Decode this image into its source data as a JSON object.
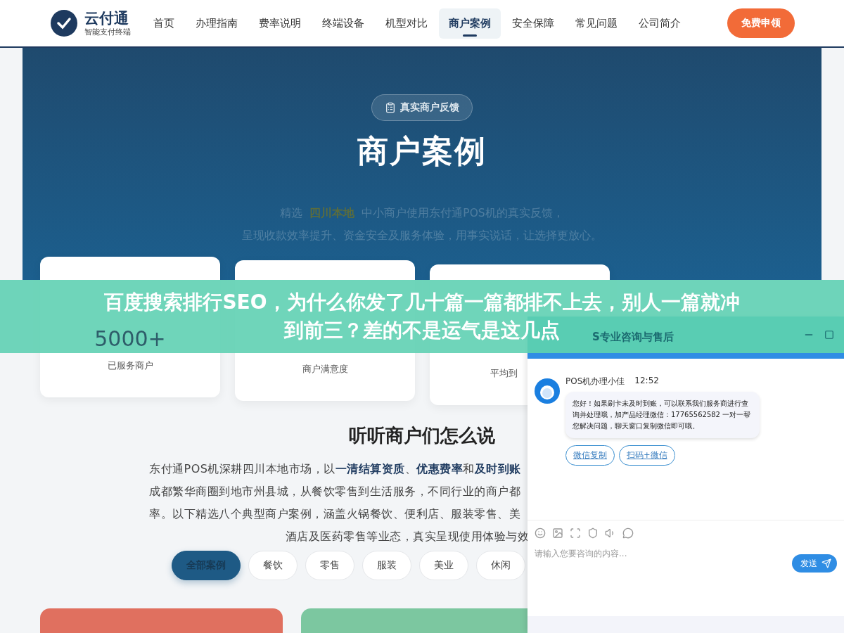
{
  "header": {
    "logo": {
      "name": "云付通",
      "tagline": "智能支付终端"
    },
    "nav": [
      {
        "label": "首页",
        "selected": false
      },
      {
        "label": "办理指南",
        "selected": false
      },
      {
        "label": "费率说明",
        "selected": false
      },
      {
        "label": "终端设备",
        "selected": false
      },
      {
        "label": "机型对比",
        "selected": false
      },
      {
        "label": "商户案例",
        "selected": true
      },
      {
        "label": "安全保障",
        "selected": false
      },
      {
        "label": "常见问题",
        "selected": false
      },
      {
        "label": "公司简介",
        "selected": false
      }
    ],
    "cta": "免费申领"
  },
  "hero": {
    "badge": "真实商户反馈",
    "title": "商户案例",
    "subtitle": {
      "lead": "精选",
      "highlight": "四川本地",
      "rest": "中小商户使用东付通POS机的真实反馈，",
      "line2": "呈现收款效率提升、资金安全及服务体验，用事实说话，让选择更放心。"
    }
  },
  "stats": [
    {
      "value": "5000+",
      "label": "已服务商户"
    },
    {
      "label": "商户满意度"
    },
    {
      "label": "平均到"
    }
  ],
  "section": {
    "title": "听听商户们怎么说",
    "intro_lines": [
      "东付通POS机深耕四川本地市场，以**一清结算资质**、**优惠费率**和**及时到账**",
      "成都繁华商圈到地市州县城，从餐饮零售到生活服务，不同行业的商户都",
      "率。以下精选八个典型商户案例，涵盖火锅餐饮、便利店、服装零售、美",
      "酒店及医药零售等业态，真实呈现使用体验与效"
    ],
    "filters": [
      {
        "label": "全部案例",
        "selected": true
      },
      {
        "label": "餐饮",
        "selected": false
      },
      {
        "label": "零售",
        "selected": false
      },
      {
        "label": "服装",
        "selected": false
      },
      {
        "label": "美业",
        "selected": false
      },
      {
        "label": "休闲",
        "selected": false
      }
    ],
    "case_cards": [
      {
        "color": "#e0705f"
      },
      {
        "color": "#7cc7a0"
      }
    ]
  },
  "banner": {
    "title_lines": [
      "百度搜索排行SEO，为什么你发了几十篇一篇都排不上去，别人一篇就冲",
      "到前三？差的不是运气是这几点"
    ]
  },
  "chat": {
    "title": "S专业咨询与售后",
    "message": {
      "sender": "POS机办理小佳",
      "time": "12:52",
      "text": "您好！如果刷卡未及时到账，可以联系我们服务商进行查询并处理哦，加产品经理微信：17765562582 一对一帮您解决问题，聊天窗口复制微信即可哦。"
    },
    "actions": [
      "微信复制",
      "扫码+微信"
    ],
    "input": {
      "placeholder": "请输入您要咨询的内容..."
    },
    "send": "发送"
  }
}
